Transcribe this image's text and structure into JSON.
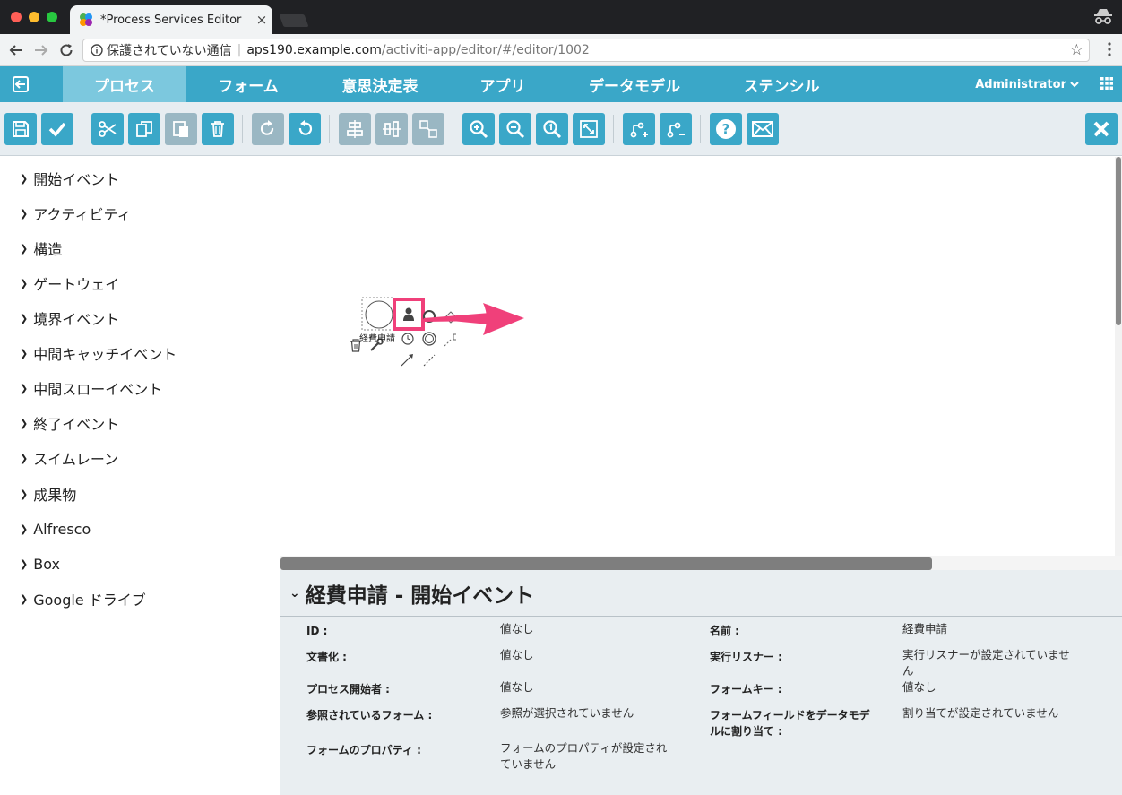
{
  "browser": {
    "tab_title": "*Process Services Editor",
    "security_label": "保護されていない通信",
    "url_host": "aps190.example.com",
    "url_path": "/activiti-app/editor/#/editor/1002"
  },
  "appnav": {
    "tabs": [
      "プロセス",
      "フォーム",
      "意思決定表",
      "アプリ",
      "データモデル",
      "ステンシル"
    ],
    "active_tab": "プロセス",
    "user": "Administrator"
  },
  "toolbar": {
    "buttons": [
      "save-icon",
      "check-icon",
      "scissors-icon",
      "copy-icon",
      "paste-icon",
      "trash-icon",
      "redo-icon",
      "undo-icon",
      "align-vertical-icon",
      "align-horizontal-icon",
      "resize-icon",
      "zoom-in-icon",
      "zoom-out-icon",
      "zoom-actual-icon",
      "zoom-fit-icon",
      "add-bendpoint-icon",
      "remove-bendpoint-icon",
      "help-icon",
      "mail-icon",
      "close-icon"
    ]
  },
  "palette": {
    "items": [
      "開始イベント",
      "アクティビティ",
      "構造",
      "ゲートウェイ",
      "境界イベント",
      "中間キャッチイベント",
      "中間スローイベント",
      "終了イベント",
      "スイムレーン",
      "成果物",
      "Alfresco",
      "Box",
      "Google ドライブ"
    ]
  },
  "canvas": {
    "start_event_label": "経費申請"
  },
  "properties": {
    "title": "経費申請 - 開始イベント",
    "left": [
      {
        "label": "ID :",
        "value": "値なし"
      },
      {
        "label": "文書化 :",
        "value": "値なし"
      },
      {
        "label": "プロセス開始者 :",
        "value": "値なし"
      },
      {
        "label": "参照されているフォーム :",
        "value": "参照が選択されていません"
      },
      {
        "label": "フォームのプロパティ :",
        "value_line1": "フォームのプロパティが設定され",
        "value_line2": "ていません"
      }
    ],
    "right": [
      {
        "label": "名前 :",
        "value": "経費申請"
      },
      {
        "label": "実行リスナー :",
        "value_line1": "実行リスナーが設定されていませ",
        "value_line2": "ん"
      },
      {
        "label": "フォームキー :",
        "value": "値なし"
      },
      {
        "label_line1": "フォームフィールドをデータモデ",
        "label_line2": "ルに割り当て :",
        "value": "割り当てが設定されていません"
      }
    ]
  },
  "colors": {
    "brand": "#3aa7c8",
    "active_tab": "#7cc8de",
    "highlight": "#f0407a"
  }
}
